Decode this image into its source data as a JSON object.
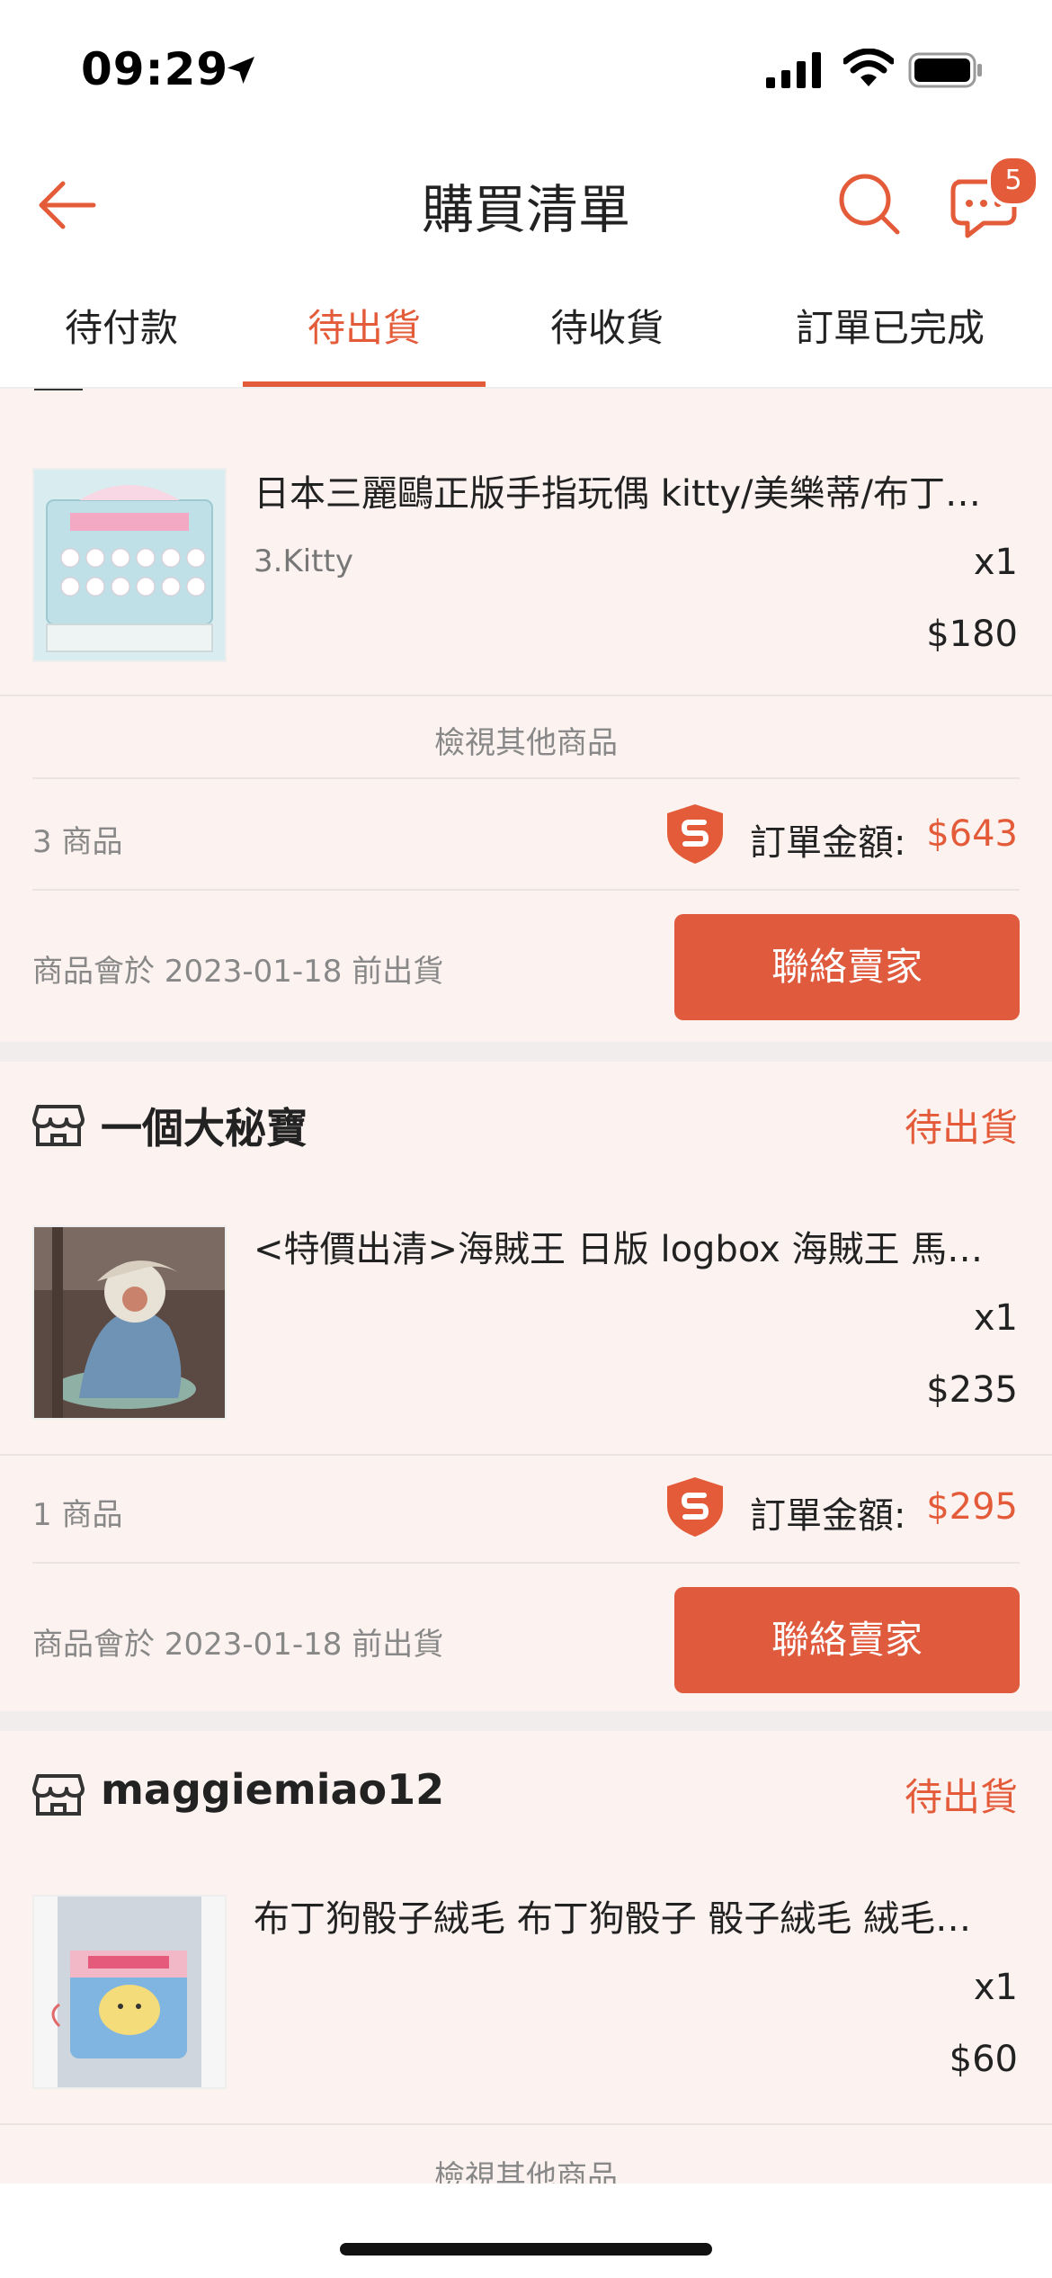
{
  "status_bar": {
    "time": "09:29"
  },
  "nav": {
    "title": "購買清單",
    "chat_badge": "5"
  },
  "tabs": [
    {
      "label": "待付款"
    },
    {
      "label": "待出貨"
    },
    {
      "label": "待收貨"
    },
    {
      "label": "訂單已完成"
    }
  ],
  "orders": [
    {
      "product": {
        "name": "日本三麗鷗正版手指玩偶 kitty/美樂蒂/布丁狗/酷洛米",
        "variant": "3.Kitty",
        "qty": "x1",
        "price": "$180"
      },
      "view_more": "檢視其他商品",
      "count": "3 商品",
      "total_label": "訂單金額:",
      "total": "$643",
      "ship_note": "商品會於 2023-01-18 前出貨",
      "contact": "聯絡賣家"
    },
    {
      "shop": "一個大秘寶",
      "status": "待出貨",
      "product": {
        "name": "<特價出清>海賊王 日版 logbox 海賊王 馬林福特",
        "qty": "x1",
        "price": "$235"
      },
      "count": "1 商品",
      "total_label": "訂單金額:",
      "total": "$295",
      "ship_note": "商品會於 2023-01-18 前出貨",
      "contact": "聯絡賣家"
    },
    {
      "shop": "maggiemiao12",
      "status": "待出貨",
      "product": {
        "name": "布丁狗骰子絨毛 布丁狗骰子 骰子絨毛 絨毛吊飾",
        "qty": "x1",
        "price": "$60"
      },
      "view_more": "檢視其他商品"
    }
  ],
  "colors": {
    "accent": "#e45b3a",
    "button": "#e05a3d",
    "background": "#fcf3f0"
  }
}
